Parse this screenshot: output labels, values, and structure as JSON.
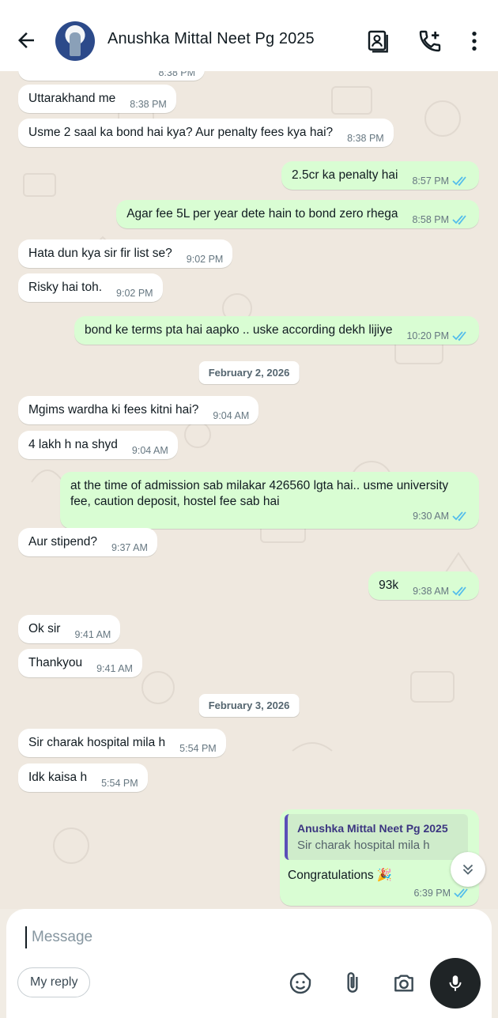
{
  "header": {
    "contact_name": "Anushka Mittal Neet Pg 2025"
  },
  "messages": [
    {
      "dir": "in",
      "text": "Uttarakhand me",
      "time": "8:38 PM"
    },
    {
      "dir": "in",
      "text": "Usme 2 saal ka bond hai kya? Aur penalty fees kya hai?",
      "time": "8:38 PM"
    },
    {
      "dir": "out",
      "text": "2.5cr ka penalty hai",
      "time": "8:57 PM"
    },
    {
      "dir": "out",
      "text": "Agar fee 5L per year dete hain to bond zero rhega",
      "time": "8:58 PM"
    },
    {
      "dir": "in",
      "text": "Hata dun kya sir fir list se?",
      "time": "9:02 PM"
    },
    {
      "dir": "in",
      "text": "Risky hai toh.",
      "time": "9:02 PM"
    },
    {
      "dir": "out",
      "text": "bond ke terms pta hai aapko .. uske according dekh lijiye",
      "time": "10:20 PM"
    },
    {
      "dir": "in",
      "text": "Mgims wardha ki fees kitni hai?",
      "time": "9:04 AM"
    },
    {
      "dir": "in",
      "text": "4 lakh h na shyd",
      "time": "9:04 AM"
    },
    {
      "dir": "out",
      "text": "at the time of admission sab milakar 426560 lgta hai.. usme university fee, caution deposit, hostel fee sab hai",
      "time": "9:30 AM"
    },
    {
      "dir": "in",
      "text": "Aur stipend?",
      "time": "9:37 AM"
    },
    {
      "dir": "out",
      "text": "93k",
      "time": "9:38 AM"
    },
    {
      "dir": "in",
      "text": "Ok sir",
      "time": "9:41 AM"
    },
    {
      "dir": "in",
      "text": "Thankyou",
      "time": "9:41 AM"
    },
    {
      "dir": "in",
      "text": "Sir charak hospital mila h",
      "time": "5:54 PM"
    },
    {
      "dir": "in",
      "text": "Idk kaisa h",
      "time": "5:54 PM"
    },
    {
      "dir": "out",
      "text": "Congratulations 🎉",
      "time": "6:39 PM",
      "reply_to_name": "Anushka Mittal Neet Pg 2025",
      "reply_to_text": "Sir charak hospital mila h"
    }
  ],
  "dates": [
    "February 2, 2026",
    "February 3, 2026"
  ],
  "partial_top_time": "8:38 PM",
  "composer": {
    "placeholder": "Message",
    "my_reply_label": "My reply"
  },
  "colors": {
    "outgoing_bubble": "#d9fdd3",
    "incoming_bubble": "#ffffff",
    "read_tick": "#53bdeb",
    "chat_bg": "#efe8df"
  },
  "icons": [
    "back-arrow-icon",
    "contact-card-icon",
    "add-call-icon",
    "more-vert-icon",
    "double-chevron-down-icon",
    "sticker-icon",
    "attach-icon",
    "camera-icon",
    "mic-icon"
  ]
}
